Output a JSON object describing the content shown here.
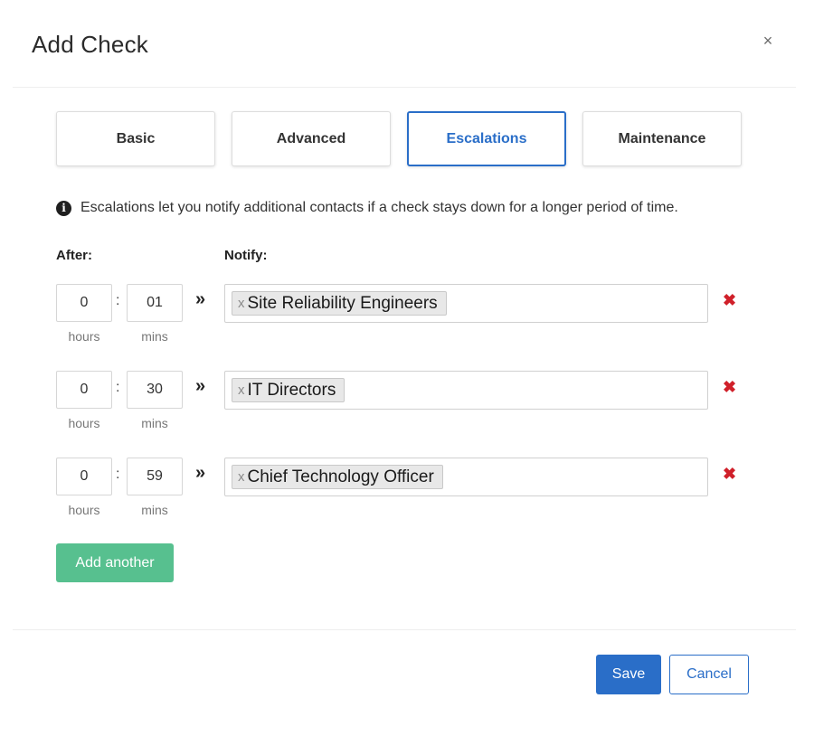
{
  "modal": {
    "title": "Add Check",
    "close_icon": "×"
  },
  "tabs": [
    {
      "label": "Basic",
      "active": false
    },
    {
      "label": "Advanced",
      "active": false
    },
    {
      "label": "Escalations",
      "active": true
    },
    {
      "label": "Maintenance",
      "active": false
    }
  ],
  "info": {
    "icon": "info-icon",
    "text": "Escalations let you notify additional contacts if a check stays down for a longer period of time."
  },
  "columns": {
    "after": "After:",
    "notify": "Notify:"
  },
  "escalations": [
    {
      "hours": "0",
      "mins": "01",
      "hours_label": "hours",
      "mins_label": "mins",
      "colon": ":",
      "arrow": "»",
      "contact": "Site Reliability Engineers",
      "tag_remove": "x",
      "remove_icon": "✖"
    },
    {
      "hours": "0",
      "mins": "30",
      "hours_label": "hours",
      "mins_label": "mins",
      "colon": ":",
      "arrow": "»",
      "contact": "IT Directors",
      "tag_remove": "x",
      "remove_icon": "✖"
    },
    {
      "hours": "0",
      "mins": "59",
      "hours_label": "hours",
      "mins_label": "mins",
      "colon": ":",
      "arrow": "»",
      "contact": "Chief Technology Officer",
      "tag_remove": "x",
      "remove_icon": "✖"
    }
  ],
  "buttons": {
    "add_another": "Add another",
    "save": "Save",
    "cancel": "Cancel"
  },
  "colors": {
    "primary": "#2a6ec8",
    "success": "#57c08f",
    "danger": "#d0202a"
  }
}
